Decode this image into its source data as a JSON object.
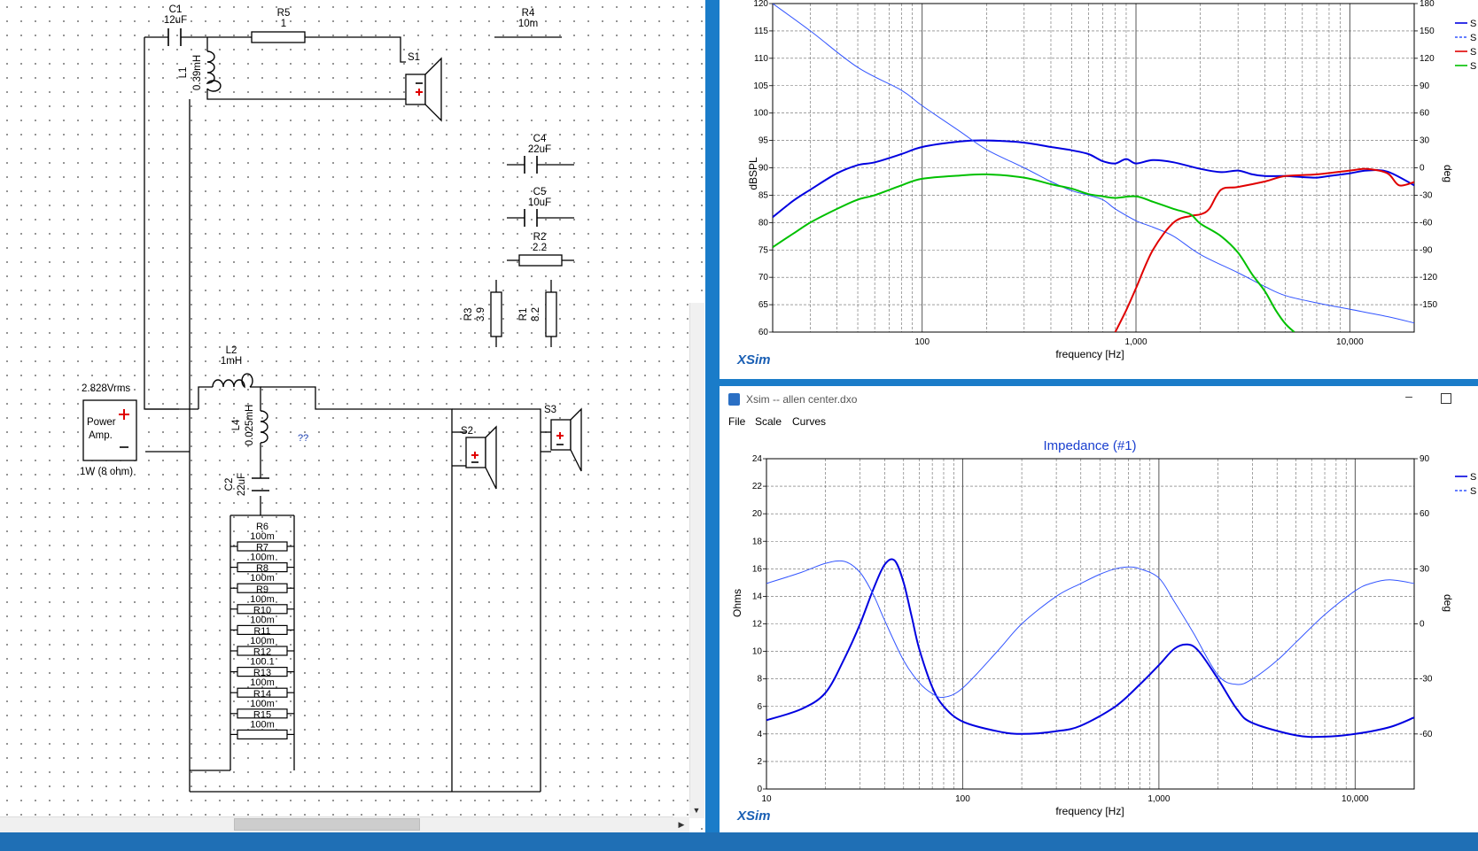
{
  "schematic": {
    "components": [
      {
        "id": "C1",
        "value": "12uF"
      },
      {
        "id": "R5",
        "value": "1"
      },
      {
        "id": "R4",
        "value": "10m"
      },
      {
        "id": "L1",
        "value": "0.39mH"
      },
      {
        "id": "S1",
        "value": ""
      },
      {
        "id": "C4",
        "value": "22uF"
      },
      {
        "id": "C5",
        "value": "10uF"
      },
      {
        "id": "R2",
        "value": "2.2"
      },
      {
        "id": "R3",
        "value": "3.9"
      },
      {
        "id": "R1",
        "value": "8.2"
      },
      {
        "id": "L2",
        "value": "1mH"
      },
      {
        "id": "L4",
        "value": "0.025mH"
      },
      {
        "id": "C2",
        "value": "22uF"
      },
      {
        "id": "S2",
        "value": ""
      },
      {
        "id": "S3",
        "value": ""
      }
    ],
    "resistor_stack": [
      {
        "id": "R6",
        "value": "100m"
      },
      {
        "id": "R7",
        "value": "100m"
      },
      {
        "id": "R8",
        "value": "100m"
      },
      {
        "id": "R9",
        "value": "100m"
      },
      {
        "id": "R10",
        "value": "100m"
      },
      {
        "id": "R11",
        "value": "100m"
      },
      {
        "id": "R12",
        "value": "100.1"
      },
      {
        "id": "R13",
        "value": "100m"
      },
      {
        "id": "R14",
        "value": "100m"
      },
      {
        "id": "R15",
        "value": "100m"
      }
    ],
    "amp": {
      "voltage": "2.828Vrms",
      "label1": "Power",
      "label2": "Amp.",
      "power": "1W (8 ohm)"
    },
    "unknown_marker": "??"
  },
  "spl_chart": {
    "app_logo": "XSim",
    "ylabel": "dBSPL",
    "ylabel_right": "deg",
    "xlabel": "frequency [Hz]",
    "y_ticks": [
      "60",
      "65",
      "70",
      "75",
      "80",
      "85",
      "90",
      "95",
      "100",
      "105",
      "110",
      "115",
      "120"
    ],
    "y_right_ticks": [
      "-150",
      "-120",
      "-90",
      "-60",
      "-30",
      "0",
      "30",
      "60",
      "90",
      "120",
      "150",
      "180"
    ],
    "x_ticks": [
      "100",
      "1,000",
      "10,000"
    ],
    "legend": [
      "S",
      "S",
      "S",
      "S"
    ],
    "colors": {
      "total": "#0000e0",
      "phase": "#3355ff",
      "red": "#e00000",
      "green": "#00c000"
    }
  },
  "impedance_window": {
    "title": "Xsim -- allen center.dxo",
    "menu": [
      "File",
      "Scale",
      "Curves"
    ]
  },
  "impedance_chart": {
    "title": "Impedance (#1)",
    "app_logo": "XSim",
    "ylabel": "Ohms",
    "ylabel_right": "deg",
    "xlabel": "frequency [Hz]",
    "y_ticks": [
      "0",
      "2",
      "4",
      "6",
      "8",
      "10",
      "12",
      "14",
      "16",
      "18",
      "20",
      "22",
      "24"
    ],
    "y_right_ticks": [
      "-60",
      "-30",
      "0",
      "30",
      "60",
      "90"
    ],
    "x_ticks": [
      "10",
      "100",
      "1,000",
      "10,000"
    ],
    "legend": [
      "S",
      "S"
    ]
  },
  "chart_data": [
    {
      "type": "line",
      "title": "",
      "xlabel": "frequency [Hz]",
      "ylabel": "dBSPL",
      "x_scale": "log",
      "xlim": [
        20,
        20000
      ],
      "ylim": [
        60,
        120
      ],
      "y2lim": [
        -180,
        180
      ],
      "grid": true,
      "legend_placement": "right",
      "series": [
        {
          "axis": "left",
          "color": "#0000e0",
          "x": [
            20,
            25,
            30,
            40,
            50,
            60,
            80,
            100,
            150,
            200,
            300,
            400,
            500,
            600,
            700,
            800,
            900,
            1000,
            1200,
            1500,
            2000,
            2500,
            3000,
            3500,
            4000,
            5000,
            6000,
            7000,
            8000,
            10000,
            12000,
            15000,
            20000
          ],
          "y": [
            81,
            84,
            86,
            89,
            90.5,
            91,
            92.5,
            93.8,
            94.8,
            95,
            94.6,
            93.8,
            93.2,
            92.5,
            91.2,
            90.8,
            91.6,
            90.8,
            91.4,
            91,
            89.8,
            89.2,
            89.5,
            88.8,
            88.5,
            88.5,
            88.3,
            88.2,
            88.5,
            89,
            89.5,
            89.3,
            86.8
          ]
        },
        {
          "axis": "right",
          "color": "#3355ff",
          "x": [
            20,
            30,
            50,
            80,
            100,
            150,
            200,
            300,
            400,
            500,
            600,
            700,
            800,
            1000,
            1200,
            1500,
            2000,
            3000,
            4000,
            5000,
            7000,
            10000,
            15000,
            20000
          ],
          "y": [
            180,
            150,
            110,
            85,
            68,
            40,
            20,
            0,
            -15,
            -25,
            -30,
            -35,
            -45,
            -58,
            -65,
            -75,
            -95,
            -115,
            -130,
            -140,
            -148,
            -155,
            -163,
            -170
          ]
        },
        {
          "axis": "left",
          "color": "#e00000",
          "x": [
            800,
            900,
            1000,
            1200,
            1500,
            1800,
            2000,
            2200,
            2500,
            3000,
            4000,
            5000,
            7000,
            10000,
            12000,
            15000,
            17000,
            20000
          ],
          "y": [
            60,
            64,
            68,
            75,
            80,
            81.2,
            81.5,
            82.5,
            86,
            86.5,
            87.5,
            88.5,
            88.8,
            89.5,
            89.8,
            89,
            86.8,
            87.4
          ]
        },
        {
          "axis": "left",
          "color": "#00c000",
          "x": [
            20,
            25,
            30,
            40,
            50,
            60,
            80,
            100,
            150,
            200,
            300,
            400,
            500,
            600,
            700,
            800,
            1000,
            1200,
            1500,
            1800,
            2000,
            2500,
            3000,
            3500,
            4000,
            4500,
            5000,
            5500
          ],
          "y": [
            75.5,
            78,
            80,
            82.5,
            84.2,
            85,
            86.8,
            88,
            88.6,
            88.8,
            88.2,
            87,
            86.2,
            85.2,
            84.8,
            84.5,
            84.8,
            83.8,
            82.5,
            81.5,
            79.8,
            77.5,
            74.5,
            70.5,
            67.5,
            64,
            61.5,
            60
          ]
        }
      ]
    },
    {
      "type": "line",
      "title": "Impedance (#1)",
      "xlabel": "frequency [Hz]",
      "ylabel": "Ohms",
      "x_scale": "log",
      "xlim": [
        10,
        20000
      ],
      "ylim": [
        0,
        24
      ],
      "y2lim": [
        -90,
        90
      ],
      "grid": true,
      "legend_placement": "right",
      "series": [
        {
          "axis": "left",
          "color": "#0000e0",
          "x": [
            10,
            15,
            20,
            25,
            30,
            35,
            40,
            45,
            50,
            55,
            60,
            70,
            80,
            100,
            150,
            200,
            300,
            400,
            600,
            800,
            1000,
            1200,
            1400,
            1600,
            2000,
            2500,
            3000,
            5000,
            7000,
            10000,
            15000,
            20000
          ],
          "y": [
            5,
            5.8,
            7,
            9.5,
            12,
            14.5,
            16.3,
            16.6,
            15,
            12.5,
            10.2,
            7.4,
            6,
            4.9,
            4.2,
            4,
            4.2,
            4.6,
            6,
            7.6,
            9,
            10.2,
            10.5,
            10,
            8,
            5.8,
            4.8,
            3.9,
            3.8,
            4,
            4.5,
            5.2
          ]
        },
        {
          "axis": "right",
          "color": "#3355ff",
          "x": [
            10,
            15,
            20,
            25,
            30,
            35,
            40,
            50,
            60,
            70,
            80,
            100,
            150,
            200,
            300,
            400,
            500,
            600,
            700,
            800,
            1000,
            1200,
            1500,
            2000,
            2500,
            3000,
            4000,
            5000,
            7000,
            10000,
            12000,
            15000,
            20000
          ],
          "y": [
            22,
            28,
            33,
            34,
            28,
            16,
            2,
            -20,
            -32,
            -38,
            -40,
            -35,
            -15,
            0,
            15,
            22,
            27,
            30,
            31,
            30,
            25,
            12,
            -5,
            -28,
            -33,
            -30,
            -20,
            -10,
            5,
            18,
            22,
            24,
            22
          ]
        }
      ]
    }
  ]
}
